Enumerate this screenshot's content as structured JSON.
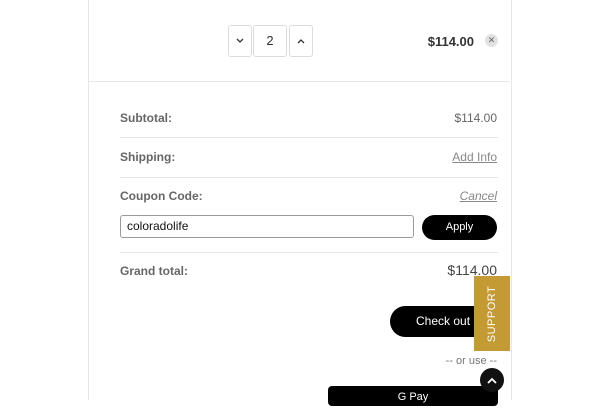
{
  "cart_item": {
    "quantity": "2",
    "price": "$114.00",
    "decrease_icon": "chevron-down-icon",
    "increase_icon": "chevron-up-icon",
    "remove_icon": "close-icon"
  },
  "summary": {
    "subtotal_label": "Subtotal:",
    "subtotal_value": "$114.00",
    "shipping_label": "Shipping:",
    "shipping_link": "Add Info",
    "coupon_label": "Coupon Code:",
    "coupon_cancel": "Cancel",
    "coupon_value": "coloradolife",
    "apply_label": "Apply",
    "grand_total_label": "Grand total:",
    "grand_total_value": "$114.00"
  },
  "checkout": {
    "checkout_label": "Check out",
    "or_use": "-- or use --",
    "gpay_label": "G Pay"
  },
  "support_tab": {
    "label": "SUPPORT"
  },
  "colors": {
    "accent_gold": "#c49a35",
    "button_black": "#000000"
  }
}
